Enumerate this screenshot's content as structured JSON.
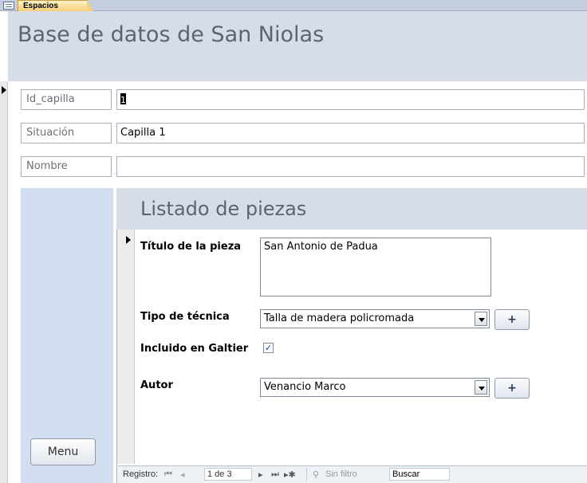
{
  "tab": {
    "label": "Espacios"
  },
  "form": {
    "title": "Base de datos de San Niolas"
  },
  "fields": [
    {
      "label": "Id_capilla",
      "value": "1"
    },
    {
      "label": "Situación",
      "value": "Capilla 1"
    },
    {
      "label": "Nombre",
      "value": ""
    }
  ],
  "menu_button": "Menu",
  "subform": {
    "title": "Listado de piezas",
    "titulo_label": "Título de la pieza",
    "titulo_value": "San Antonio de Padua",
    "tecnica_label": "Tipo de técnica",
    "tecnica_value": "Talla de madera policromada",
    "galtier_label": "Incluido en Galtier",
    "galtier_checked": true,
    "autor_label": "Autor",
    "autor_value": "Venancio Marco",
    "add_label": "+"
  },
  "navigation": {
    "label": "Registro:",
    "current": "1 de 3",
    "filter": "Sin filtro",
    "search_placeholder": "Buscar"
  }
}
